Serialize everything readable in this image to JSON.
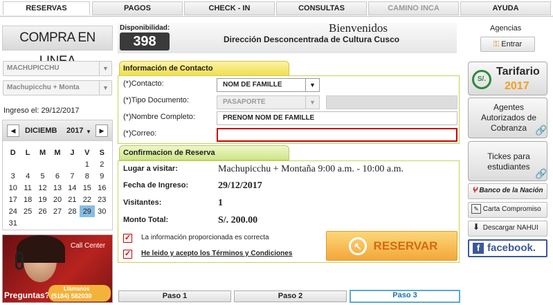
{
  "nav": {
    "tabs": [
      {
        "label": "RESERVAS",
        "state": "active"
      },
      {
        "label": "PAGOS",
        "state": "normal"
      },
      {
        "label": "CHECK - IN",
        "state": "normal"
      },
      {
        "label": "CONSULTAS",
        "state": "normal"
      },
      {
        "label": "CAMINO INCA",
        "state": "disabled"
      },
      {
        "label": "AYUDA",
        "state": "normal"
      }
    ]
  },
  "left": {
    "logo_text": "COMPRA EN LINEA",
    "place_select": "MACHUPICCHU",
    "route_select": "Machupicchu + Monta",
    "ingreso_label": "Ingreso el:",
    "ingreso_date": "29/12/2017",
    "calendar": {
      "month": "DICIEMB",
      "year": "2017",
      "weekdays": [
        "D",
        "L",
        "M",
        "M",
        "J",
        "V",
        "S"
      ],
      "weeks": [
        [
          "",
          "",
          "",
          "",
          "",
          "1",
          "2"
        ],
        [
          "3",
          "4",
          "5",
          "6",
          "7",
          "8",
          "9"
        ],
        [
          "10",
          "11",
          "12",
          "13",
          "14",
          "15",
          "16"
        ],
        [
          "17",
          "18",
          "19",
          "20",
          "21",
          "22",
          "23"
        ],
        [
          "24",
          "25",
          "26",
          "27",
          "28",
          "29",
          "30"
        ],
        [
          "31",
          "",
          "",
          "",
          "",
          "",
          ""
        ]
      ],
      "selected_day": "29"
    },
    "callcenter": {
      "label": "Call Center",
      "question": "Preguntas?",
      "phone_label": "Llámanos",
      "phone": "(5184) 582030"
    }
  },
  "header": {
    "disponibilidad_label": "Disponibilidad:",
    "disponibilidad_value": "398",
    "welcome": "Bienvenidos",
    "org": "Dirección Desconcentrada de Cultura Cusco"
  },
  "contact": {
    "section_title": "Información de Contacto",
    "contacto_label": "(*)Contacto:",
    "contacto_value": "NOM DE FAMILLE",
    "tipo_label": "(*)Tipo Documento:",
    "tipo_value": "PASAPORTE",
    "nombre_label": "(*)Nombre Completo:",
    "nombre_value": "PRENOM NOM DE FAMILLE",
    "correo_label": "(*)Correo:",
    "correo_value": ""
  },
  "confirm": {
    "section_title": "Confirmacion de Reserva",
    "lugar_label": "Lugar a visitar:",
    "lugar_value": "Machupicchu + Montaña 9:00 a.m. - 10:00 a.m.",
    "fecha_label": "Fecha de Ingreso:",
    "fecha_value": "29/12/2017",
    "visitantes_label": "Visitantes:",
    "visitantes_value": "1",
    "monto_label": "Monto Total:",
    "monto_value": "S/. 200.00",
    "check1_label": "La información proporcionada es correcta",
    "check2_label": "He leido y acepto los Términos y Condiciones",
    "reservar_label": "RESERVAR"
  },
  "steps": [
    "Paso 1",
    "Paso 2",
    "Paso 3"
  ],
  "right": {
    "agencias_label": "Agencias",
    "entrar_label": "Entrar",
    "tarifario_label": "Tarifario",
    "tarifario_year": "2017",
    "tarifario_icon_text": "S/.",
    "agentes_label": "Agentes Autorizados de Cobranza",
    "tickets_label": "Tickes para estudiantes",
    "banco_label": "Banco de la Nación",
    "carta_label": "Carta Compromiso",
    "nahui_label": "Descargar NAHUI",
    "facebook_label": "facebook."
  },
  "colors": {
    "section_yellow": "#f2dd4e",
    "section_green": "#cfe58a",
    "reservar_orange": "#f3a73a",
    "active_step": "#59a8d8",
    "error_border": "#cc0000",
    "facebook_blue": "#3b5998"
  }
}
